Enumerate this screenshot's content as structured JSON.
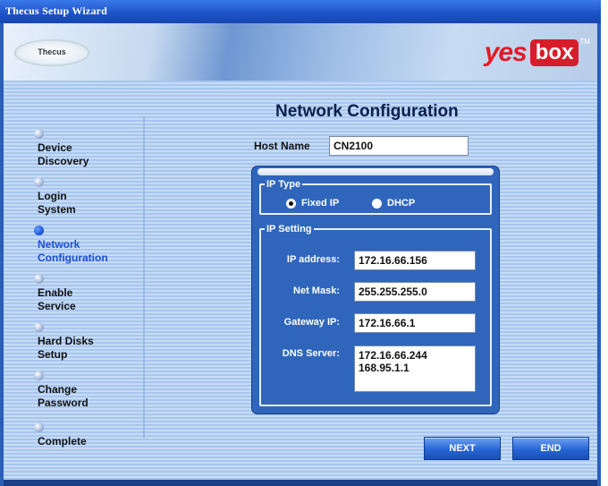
{
  "window": {
    "title": "Thecus Setup Wizard"
  },
  "banner": {
    "left_logo": "Thecus",
    "brand_main": "yes",
    "brand_box": "box",
    "brand_tm": "TM"
  },
  "sidebar": {
    "steps": [
      {
        "label": "Device\nDiscovery",
        "active": false
      },
      {
        "label": "Login\nSystem",
        "active": false
      },
      {
        "label": "Network\nConfiguration",
        "active": true
      },
      {
        "label": "Enable\nService",
        "active": false
      },
      {
        "label": "Hard Disks\nSetup",
        "active": false
      },
      {
        "label": "Change\nPassword",
        "active": false
      },
      {
        "label": "Complete",
        "active": false
      }
    ]
  },
  "main": {
    "title": "Network Configuration",
    "host_name": {
      "label": "Host Name",
      "value": "CN2100"
    },
    "ip_type": {
      "legend": "IP Type",
      "options": [
        {
          "label": "Fixed IP",
          "selected": true
        },
        {
          "label": "DHCP",
          "selected": false
        }
      ]
    },
    "ip_setting": {
      "legend": "IP Setting",
      "ip_address": {
        "label": "IP address:",
        "value": "172.16.66.156"
      },
      "net_mask": {
        "label": "Net Mask:",
        "value": "255.255.255.0"
      },
      "gateway_ip": {
        "label": "Gateway IP:",
        "value": "172.16.66.1"
      },
      "dns_server": {
        "label": "DNS Server:",
        "value": "172.16.66.244\n168.95.1.1"
      }
    }
  },
  "buttons": {
    "next": "NEXT",
    "end": "END"
  }
}
